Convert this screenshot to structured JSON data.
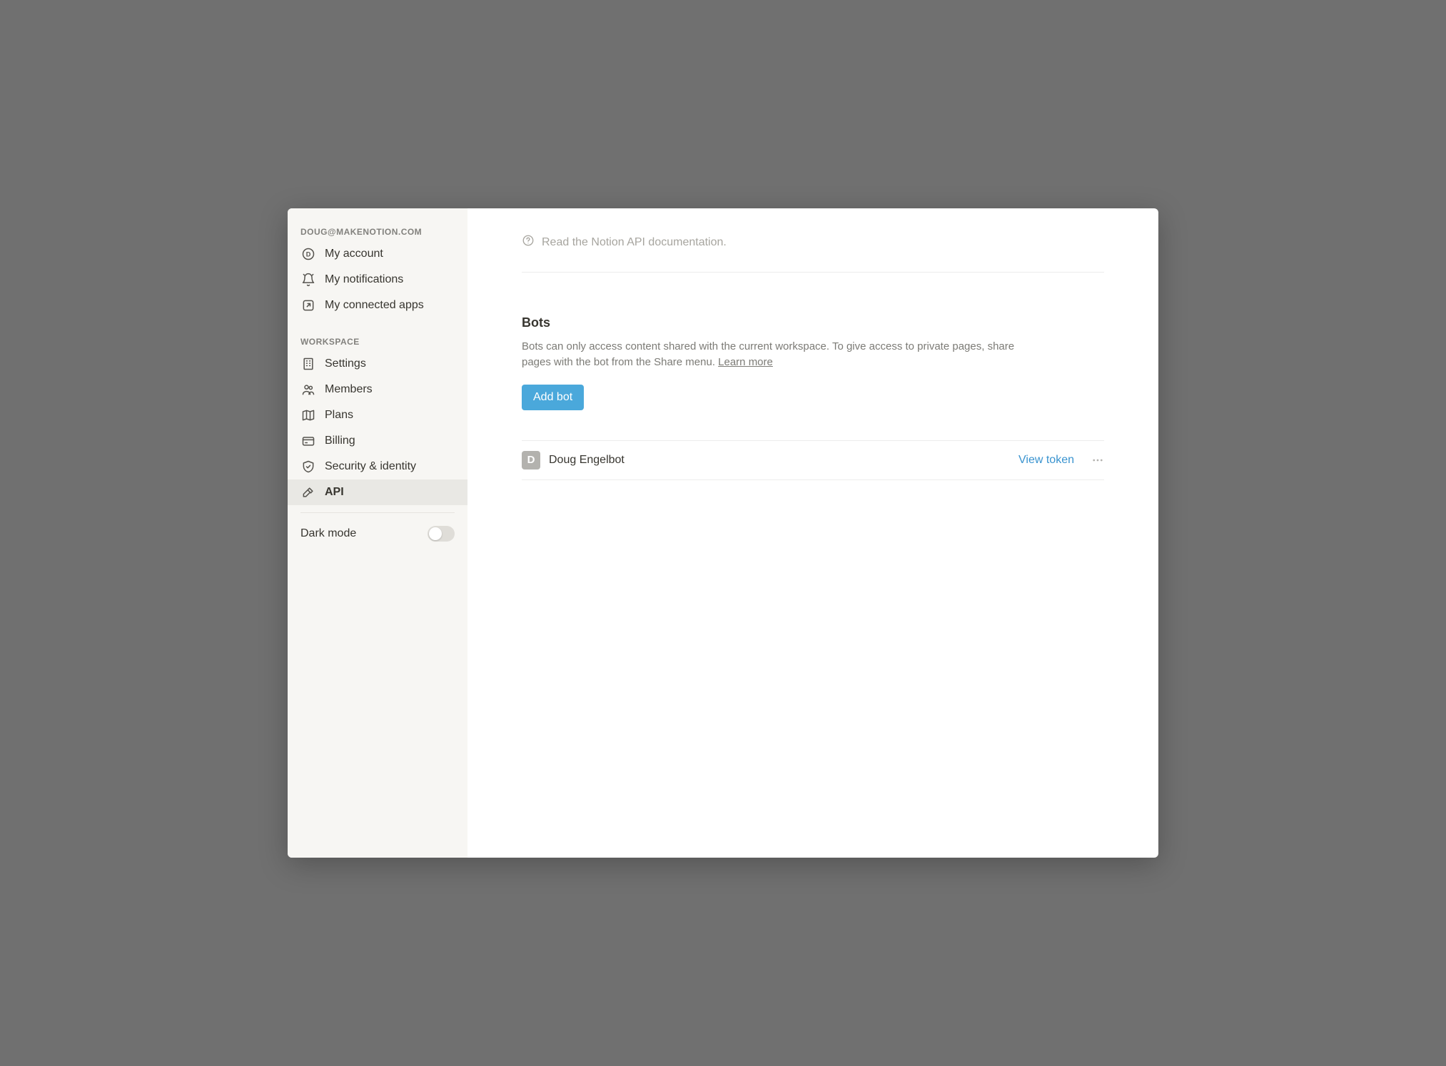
{
  "sidebar": {
    "account_header": "DOUG@MAKENOTION.COM",
    "items_account": [
      {
        "label": "My account"
      },
      {
        "label": "My notifications"
      },
      {
        "label": "My connected apps"
      }
    ],
    "workspace_header": "WORKSPACE",
    "items_workspace": [
      {
        "label": "Settings"
      },
      {
        "label": "Members"
      },
      {
        "label": "Plans"
      },
      {
        "label": "Billing"
      },
      {
        "label": "Security & identity"
      },
      {
        "label": "API"
      }
    ],
    "dark_mode_label": "Dark mode"
  },
  "main": {
    "doc_link": "Read the Notion API documentation.",
    "section_title": "Bots",
    "section_desc": "Bots can only access content shared with the current workspace. To give access to private pages, share pages with the bot from the Share menu. ",
    "learn_more": "Learn more",
    "add_bot_label": "Add bot",
    "bot": {
      "avatar_letter": "D",
      "name": "Doug Engelbot",
      "view_token": "View token"
    }
  }
}
